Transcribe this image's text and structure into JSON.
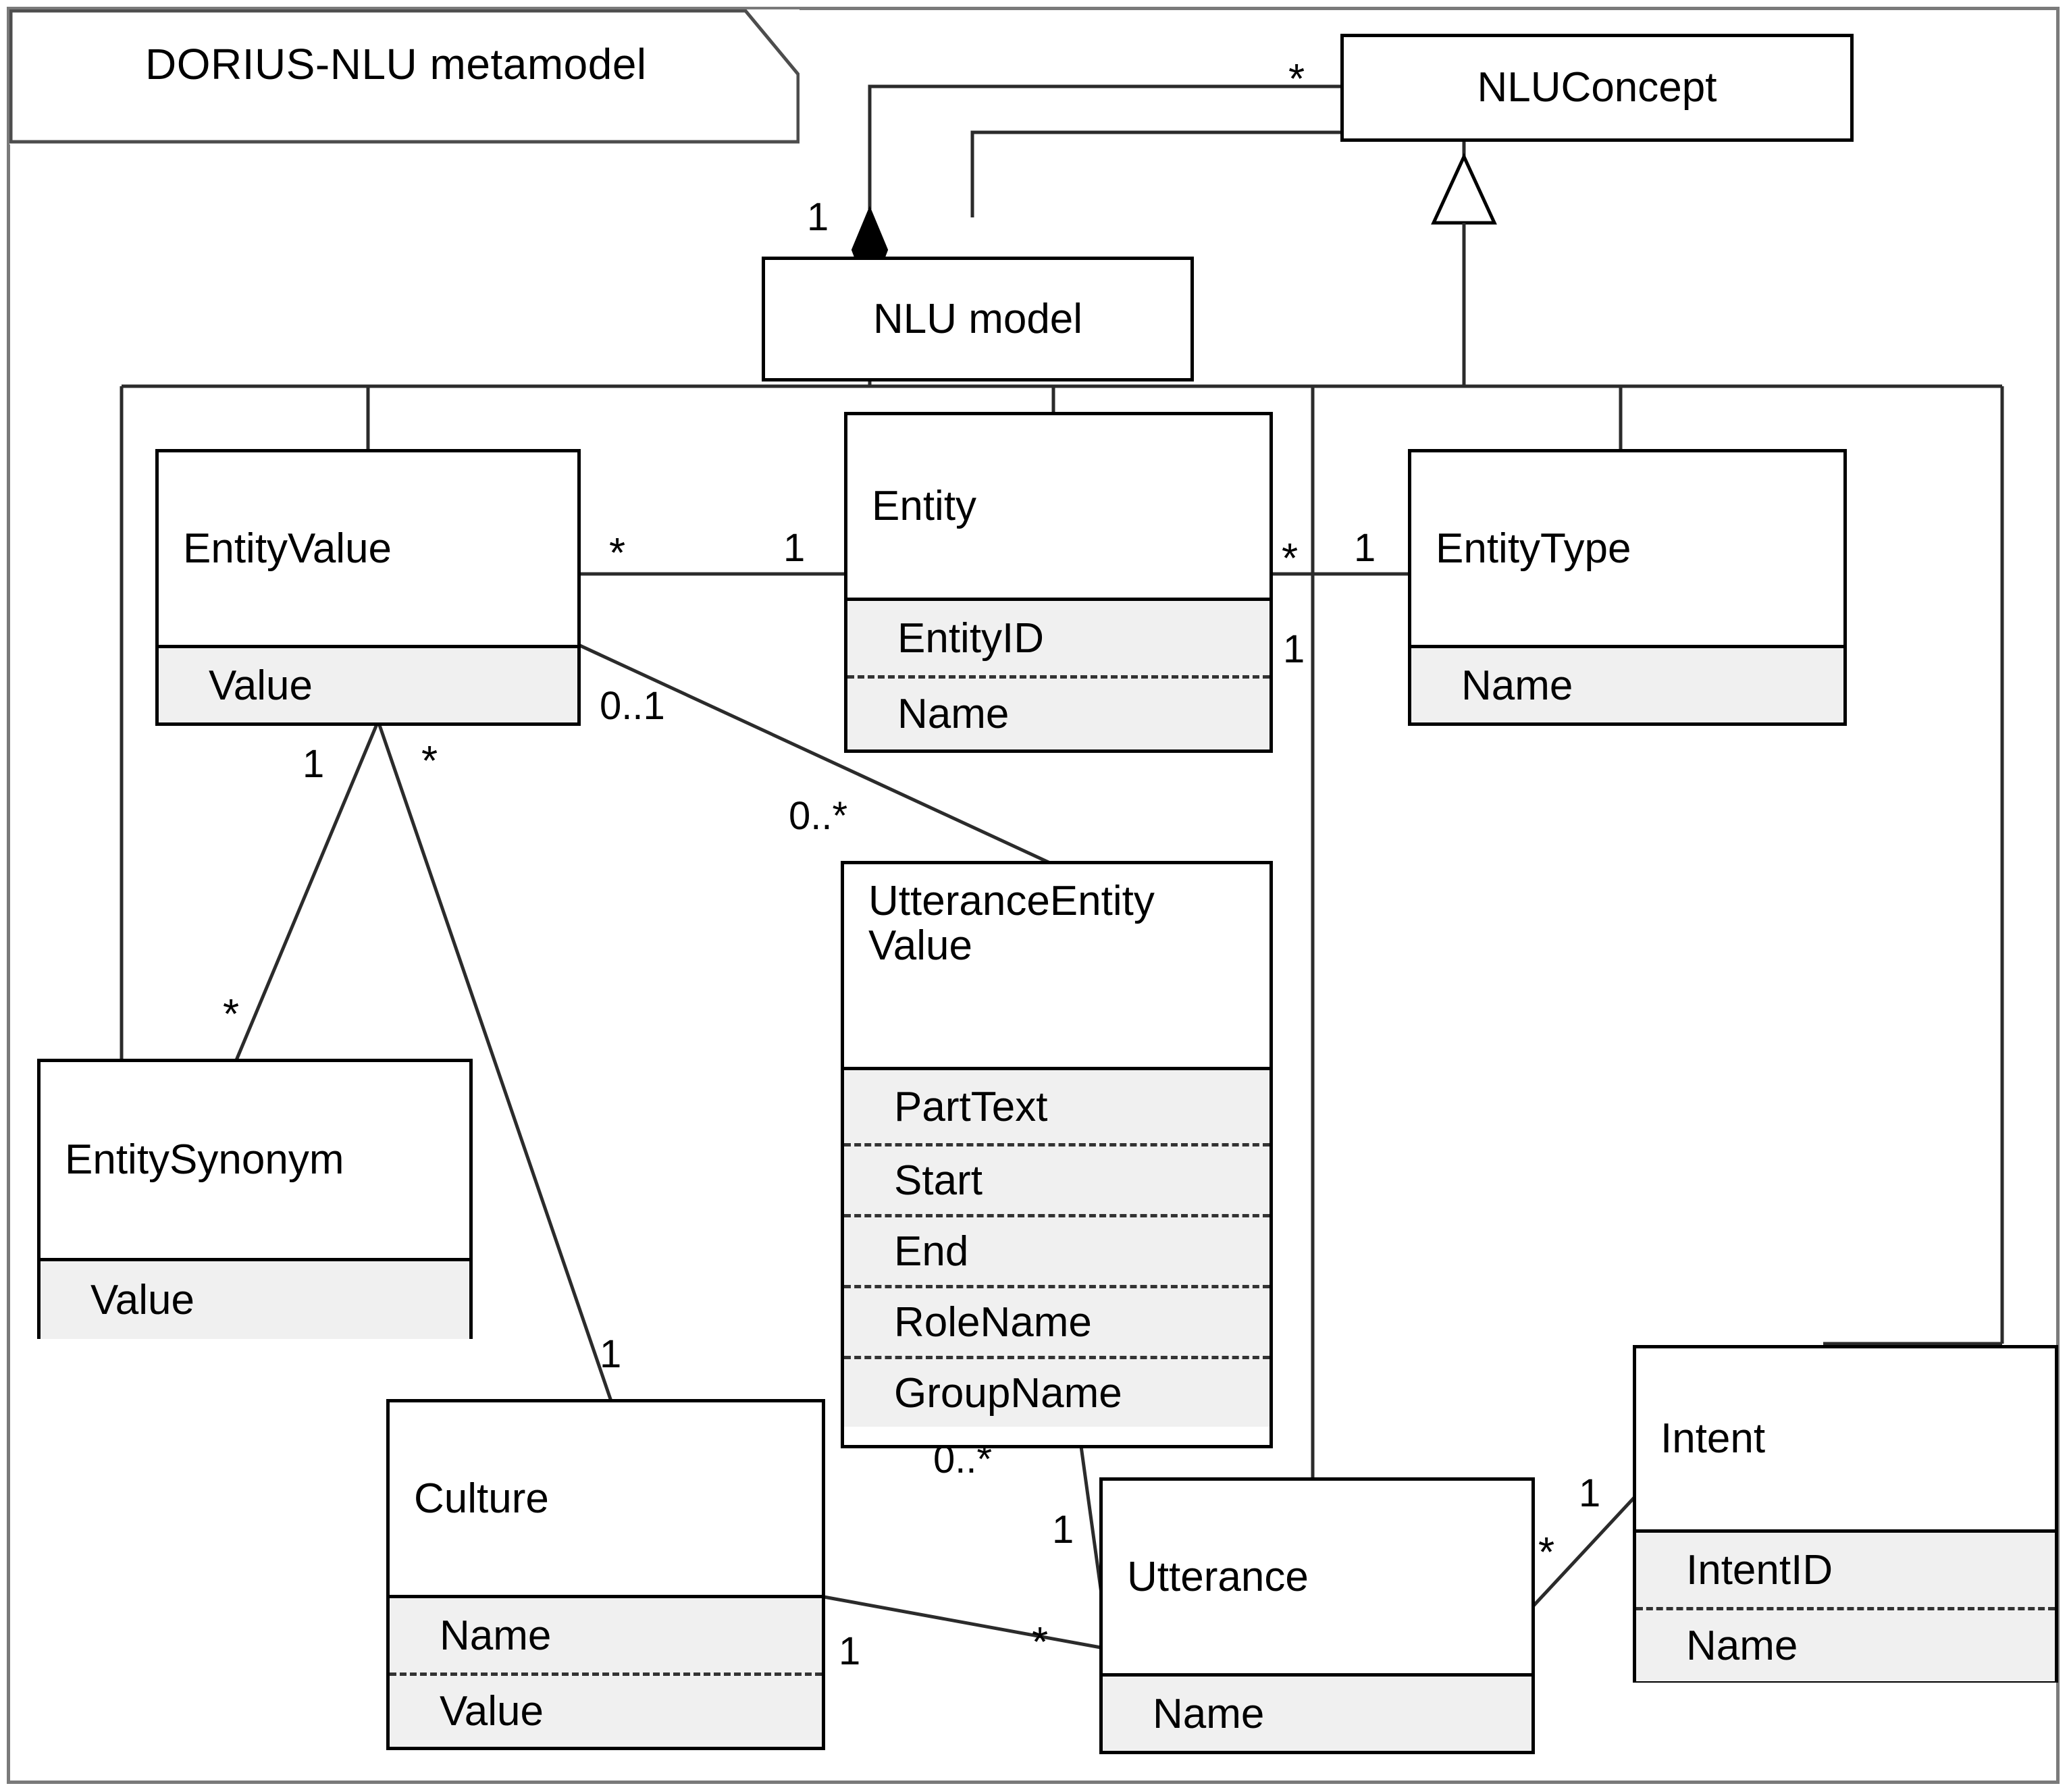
{
  "diagram": {
    "package_title": "DORIUS-NLU metamodel",
    "type": "uml-class-diagram"
  },
  "classes": [
    {
      "id": "nluconcept",
      "name": "NLUConcept",
      "attributes": []
    },
    {
      "id": "nlumodel",
      "name": "NLU model",
      "attributes": []
    },
    {
      "id": "entityvalue",
      "name": "EntityValue",
      "attributes": [
        "Value"
      ]
    },
    {
      "id": "entity",
      "name": "Entity",
      "attributes": [
        "EntityID",
        "Name"
      ]
    },
    {
      "id": "entitytype",
      "name": "EntityType",
      "attributes": [
        "Name"
      ]
    },
    {
      "id": "entitysynonym",
      "name": "EntitySynonym",
      "attributes": [
        "Value"
      ]
    },
    {
      "id": "utteranceentityvalue",
      "name": "UtteranceEntity\nValue",
      "attributes": [
        "PartText",
        "Start",
        "End",
        "RoleName",
        "GroupName"
      ]
    },
    {
      "id": "culture",
      "name": "Culture",
      "attributes": [
        "Name",
        "Value"
      ]
    },
    {
      "id": "utterance",
      "name": "Utterance",
      "attributes": [
        "Name"
      ]
    },
    {
      "id": "intent",
      "name": "Intent",
      "attributes": [
        "IntentID",
        "Name"
      ]
    }
  ],
  "multiplicities": [
    {
      "id": "m-nluconcept-star",
      "label": "*"
    },
    {
      "id": "m-nlumodel-one",
      "label": "1"
    },
    {
      "id": "m-entityvalue-star",
      "label": "*"
    },
    {
      "id": "m-entity-one",
      "label": "1"
    },
    {
      "id": "m-entity-star-right",
      "label": "*"
    },
    {
      "id": "m-entitytype-one",
      "label": "1"
    },
    {
      "id": "m-entity-one-below",
      "label": "1"
    },
    {
      "id": "m-entityvalue-zeroone",
      "label": "0..1"
    },
    {
      "id": "m-uev-zerostar-top",
      "label": "0..*"
    },
    {
      "id": "m-entityvalue-one-syn",
      "label": "1"
    },
    {
      "id": "m-entityvalue-star-culture",
      "label": "*"
    },
    {
      "id": "m-entitysynonym-star",
      "label": "*"
    },
    {
      "id": "m-culture-one",
      "label": "1"
    },
    {
      "id": "m-uev-zerostar-bottom",
      "label": "0..*"
    },
    {
      "id": "m-utterance-one",
      "label": "1"
    },
    {
      "id": "m-utterance-star-culture",
      "label": "*"
    },
    {
      "id": "m-culture-one-utterance",
      "label": "1"
    },
    {
      "id": "m-utterance-star-intent",
      "label": "*"
    },
    {
      "id": "m-intent-one",
      "label": "1"
    }
  ],
  "colors": {
    "frame": "#7a7a7a",
    "box_border": "#000000",
    "attr_fill": "#f0f0f0",
    "line": "#333333",
    "text": "#000000"
  }
}
